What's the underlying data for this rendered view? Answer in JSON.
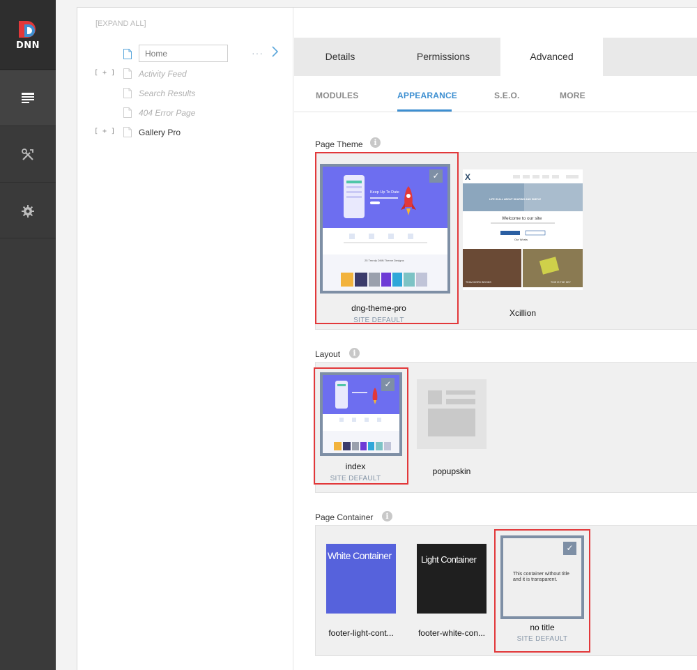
{
  "brand": {
    "logo_text": "DNN",
    "colors": {
      "red": "#e2383a",
      "blue": "#3d8fd1"
    }
  },
  "rail": {
    "items": [
      "pages-icon",
      "tools-icon",
      "gear-icon"
    ]
  },
  "tree": {
    "expand_all": "[EXPAND ALL]",
    "plus": "[ + ]",
    "items": [
      {
        "label": "Home",
        "editing": true
      },
      {
        "label": "Activity Feed",
        "has_children": true,
        "disabled": true
      },
      {
        "label": "Search Results",
        "disabled": true
      },
      {
        "label": "404 Error Page",
        "disabled": true
      },
      {
        "label": "Gallery Pro",
        "has_children": true
      }
    ],
    "more": "···"
  },
  "tabs": [
    {
      "label": "Details"
    },
    {
      "label": "Permissions"
    },
    {
      "label": "Advanced",
      "active": true
    }
  ],
  "subtabs": [
    {
      "label": "MODULES"
    },
    {
      "label": "APPEARANCE",
      "active": true
    },
    {
      "label": "S.E.O."
    },
    {
      "label": "MORE"
    }
  ],
  "sections": {
    "page_theme": {
      "title": "Page Theme",
      "items": [
        {
          "name": "dng-theme-pro",
          "sub": "SITE DEFAULT",
          "selected": true,
          "preview": {
            "headline": "Keep Up To Date",
            "bottom_line": "25 Trendy DNN Theme Designs"
          }
        },
        {
          "name": "Xcillion",
          "preview": {
            "logo": "X",
            "hero": "LIFE IS ALL ABOUT SHARING AND SIMPLE",
            "welcome": "Welcome to our site",
            "works": "Our Works",
            "caption_left": "TEAM WORK BEGINS",
            "caption_right": "THIS IS THE KEY"
          }
        }
      ]
    },
    "layout": {
      "title": "Layout",
      "items": [
        {
          "name": "index",
          "sub": "SITE DEFAULT",
          "selected": true
        },
        {
          "name": "popupskin"
        }
      ]
    },
    "page_container": {
      "title": "Page Container",
      "items": [
        {
          "name": "footer-light-cont...",
          "preview_text": "White Container",
          "color": "#5662dc"
        },
        {
          "name": "footer-white-con...",
          "preview_text": "Light Container",
          "color": "#1f1f1f"
        },
        {
          "name": "no title",
          "sub": "SITE DEFAULT",
          "selected": true,
          "preview_text": "This container without title and it is transparent."
        }
      ]
    }
  }
}
